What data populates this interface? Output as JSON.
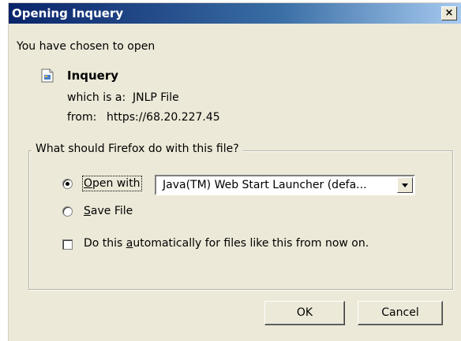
{
  "window": {
    "title": "Opening Inquery",
    "close_label": "×"
  },
  "intro": "You have chosen to open",
  "file": {
    "icon": "jnlp-file-icon",
    "name": "Inquery",
    "type_label": "which is a:",
    "type_value": "JNLP File",
    "from_label": "from:",
    "from_value": "https://68.20.227.45"
  },
  "action_group": {
    "legend": "What should Firefox do with this file?",
    "open_with": {
      "pre": "",
      "accel": "O",
      "post": "pen with",
      "selected": true
    },
    "app_select": {
      "value": "Java(TM) Web Start Launcher (defa..."
    },
    "save_file": {
      "pre": "",
      "accel": "S",
      "post": "ave File",
      "selected": false
    },
    "auto_checkbox": {
      "pre": "Do this ",
      "accel": "a",
      "post": "utomatically for files like this from now on.",
      "checked": false
    }
  },
  "buttons": {
    "ok": "OK",
    "cancel": "Cancel"
  }
}
